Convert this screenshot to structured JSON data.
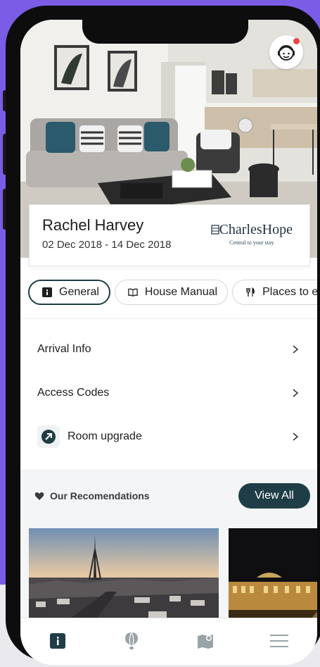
{
  "guest": {
    "name": "Rachel Harvey",
    "dates": "02 Dec 2018 - 14 Dec 2018"
  },
  "brand": {
    "name": "CharlesHope",
    "tagline": "Central to your stay"
  },
  "tabs": [
    {
      "label": "General",
      "icon": "info-icon",
      "active": true
    },
    {
      "label": "House Manual",
      "icon": "book-icon",
      "active": false
    },
    {
      "label": "Places to eat",
      "icon": "cutlery-icon",
      "active": false
    }
  ],
  "menu": {
    "arrival_info": "Arrival Info",
    "access_codes": "Access Codes",
    "room_upgrade": "Room upgrade"
  },
  "recommendations": {
    "title": "Our Recomendations",
    "view_all": "View All"
  },
  "bottom_nav": [
    {
      "icon": "info-icon",
      "active": true
    },
    {
      "icon": "hot-air-balloon-icon",
      "active": false
    },
    {
      "icon": "map-pin-icon",
      "active": false
    },
    {
      "icon": "hamburger-menu-icon",
      "active": false
    }
  ],
  "colors": {
    "accent": "#1f3d47",
    "background_outer": "#7b5ce6",
    "notification_dot": "#ef4444"
  }
}
